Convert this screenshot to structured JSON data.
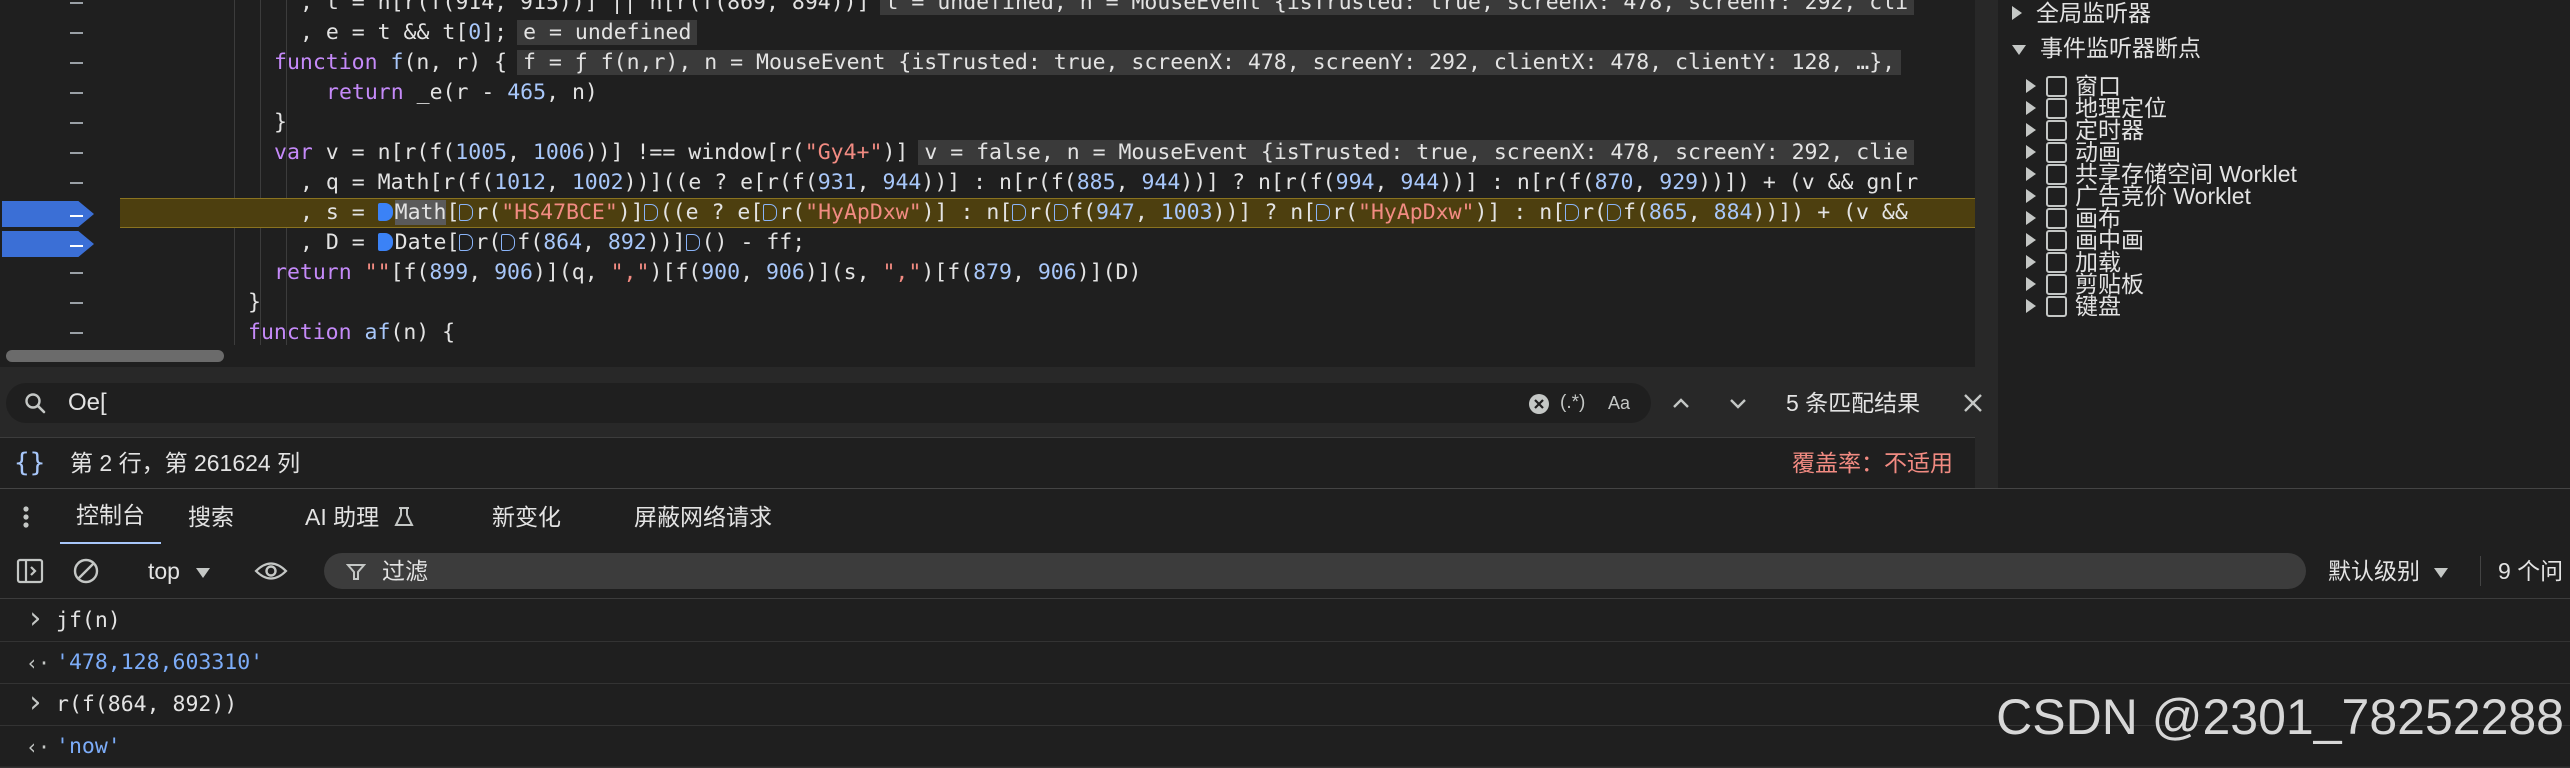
{
  "editor": {
    "lines": [
      {
        "indent": 7,
        "html": "<span class='p'>, t = n[r(f(914, 915))] || n[r(f(869, 894))]</span><span class='ival'>t = undefined, n = MouseEvent {isTrusted: true, screenX: 478, screenY: 292, cli</span>"
      },
      {
        "indent": 7,
        "html": "<span class='p'>, e = t &amp;&amp; t[</span><span class='n'>0</span><span class='p'>];</span><span class='ival'>e = undefined</span>"
      },
      {
        "indent": 6,
        "html": "<span class='k'>function</span> <span class='n'>f</span><span class='p'>(n, r) {</span><span class='ival'>f = ƒ f(n,r), n = MouseEvent {isTrusted: true, screenX: 478, screenY: 292, clientX: 478, clientY: 128, …},</span>"
      },
      {
        "indent": 8,
        "html": "<span class='k'>return</span> <span class='p'>_e(r - </span><span class='n'>465</span><span class='p'>, n)</span>"
      },
      {
        "indent": 6,
        "html": "<span class='p'>}</span>"
      },
      {
        "indent": 6,
        "html": "<span class='k'>var</span> <span class='p'>v = n[r(f(</span><span class='n'>1005</span><span class='p'>, </span><span class='n'>1006</span><span class='p'>))] !== window[r(</span><span class='s'>\"Gy4+\"</span><span class='p'>)]</span><span class='ival'>v = false, n = MouseEvent {isTrusted: true, screenX: 478, screenY: 292, clie</span>"
      },
      {
        "indent": 7,
        "html": "<span class='p'>, q = Math[r(f(</span><span class='n'>1012</span><span class='p'>, </span><span class='n'>1002</span><span class='p'>))]((e ? e[r(f(</span><span class='n'>931</span><span class='p'>, </span><span class='n'>944</span><span class='p'>))] : n[r(f(</span><span class='n'>885</span><span class='p'>, </span><span class='n'>944</span><span class='p'>))] ? n[r(f(</span><span class='n'>994</span><span class='p'>, </span><span class='n'>944</span><span class='p'>))] : n[r(f(</span><span class='n'>870</span><span class='p'>, </span><span class='n'>929</span><span class='p'>))]) + (v &amp;&amp; gn[r</span>"
      },
      {
        "indent": 7,
        "hl": true,
        "html": "<span class='p'>, s = </span><span class='mk full'></span><span class='sel'>Math</span><span class='p'>[</span><span class='mk empty'></span><span class='p'>r(</span><span class='s'>\"HS47BCE\"</span><span class='p'>)]</span><span class='mk empty'></span><span class='p'>((e ? e[</span><span class='mk empty'></span><span class='p'>r(</span><span class='s'>\"HyApDxw\"</span><span class='p'>)] : n[</span><span class='mk empty'></span><span class='p'>r(</span><span class='mk empty'></span><span class='p'>f(</span><span class='n'>947</span><span class='p'>, </span><span class='n'>1003</span><span class='p'>))] ? n[</span><span class='mk empty'></span><span class='p'>r(</span><span class='s'>\"HyApDxw\"</span><span class='p'>)] : n[</span><span class='mk empty'></span><span class='p'>r(</span><span class='mk empty'></span><span class='p'>f(</span><span class='n'>865</span><span class='p'>, </span><span class='n'>884</span><span class='p'>))]) + (v &amp;&amp;</span>"
      },
      {
        "indent": 7,
        "html": "<span class='p'>, D = </span><span class='mk full'></span><span class='p'>Date[</span><span class='mk empty'></span><span class='p'>r(</span><span class='mk empty'></span><span class='p'>f(</span><span class='n'>864</span><span class='p'>, </span><span class='n'>892</span><span class='p'>))]</span><span class='mk empty'></span><span class='p'>() - ff;</span>"
      },
      {
        "indent": 6,
        "html": "<span class='k'>return</span> <span class='s'>\"\"</span><span class='p'>[f(</span><span class='n'>899</span><span class='p'>, </span><span class='n'>906</span><span class='p'>)](q, </span><span class='s'>\",\"</span><span class='p'>)[f(</span><span class='n'>900</span><span class='p'>, </span><span class='n'>906</span><span class='p'>)](s, </span><span class='s'>\",\"</span><span class='p'>)[f(</span><span class='n'>879</span><span class='p'>, </span><span class='n'>906</span><span class='p'>)](D)</span>"
      },
      {
        "indent": 5,
        "html": "<span class='p'>}</span>"
      },
      {
        "indent": 5,
        "html": "<span class='k'>function</span> <span class='n'>af</span><span class='p'>(n) {</span>"
      }
    ]
  },
  "search": {
    "value": "Oe[",
    "regex_label": "(.*)",
    "case_label": "Aa",
    "matches": "5 条匹配结果"
  },
  "status": {
    "cursor": "第 2 行，第 261624 列",
    "coverage": "覆盖率：不适用"
  },
  "right_panel": {
    "top_partial": "......",
    "items": [
      {
        "label": "全局监听器",
        "level": 0,
        "expanded": false,
        "checkbox": false
      },
      {
        "label": "事件监听器断点",
        "level": 0,
        "expanded": true,
        "checkbox": false
      },
      {
        "label": "窗口",
        "level": 1,
        "expanded": false,
        "checkbox": true
      },
      {
        "label": "地理定位",
        "level": 1,
        "expanded": false,
        "checkbox": true
      },
      {
        "label": "定时器",
        "level": 1,
        "expanded": false,
        "checkbox": true
      },
      {
        "label": "动画",
        "level": 1,
        "expanded": false,
        "checkbox": true
      },
      {
        "label": "共享存储空间 Worklet",
        "level": 1,
        "expanded": false,
        "checkbox": true
      },
      {
        "label": "广告竞价 Worklet",
        "level": 1,
        "expanded": false,
        "checkbox": true
      },
      {
        "label": "画布",
        "level": 1,
        "expanded": false,
        "checkbox": true
      },
      {
        "label": "画中画",
        "level": 1,
        "expanded": false,
        "checkbox": true
      },
      {
        "label": "加载",
        "level": 1,
        "expanded": false,
        "checkbox": true
      },
      {
        "label": "剪贴板",
        "level": 1,
        "expanded": false,
        "checkbox": true
      },
      {
        "label": "键盘",
        "level": 1,
        "expanded": false,
        "checkbox": true
      }
    ]
  },
  "drawer": {
    "tabs": [
      "控制台",
      "搜索",
      "AI 助理",
      "新变化",
      "屏蔽网络请求"
    ],
    "context": "top",
    "filter_placeholder": "过滤",
    "level": "默认级别",
    "issues": "9 个问"
  },
  "console": {
    "rows": [
      {
        "type": "input",
        "text": "jf(n)"
      },
      {
        "type": "output",
        "text": "'478,128,603310'"
      },
      {
        "type": "input",
        "text": "r(f(864, 892))"
      },
      {
        "type": "output",
        "text": "'now'"
      }
    ]
  },
  "watermark": "CSDN @2301_78252288",
  "colors": {
    "accent": "#a8c7fa",
    "breakpoint": "#3b6fd6",
    "paused_line": "#4d3f0f",
    "coverage": "#f28b82"
  }
}
